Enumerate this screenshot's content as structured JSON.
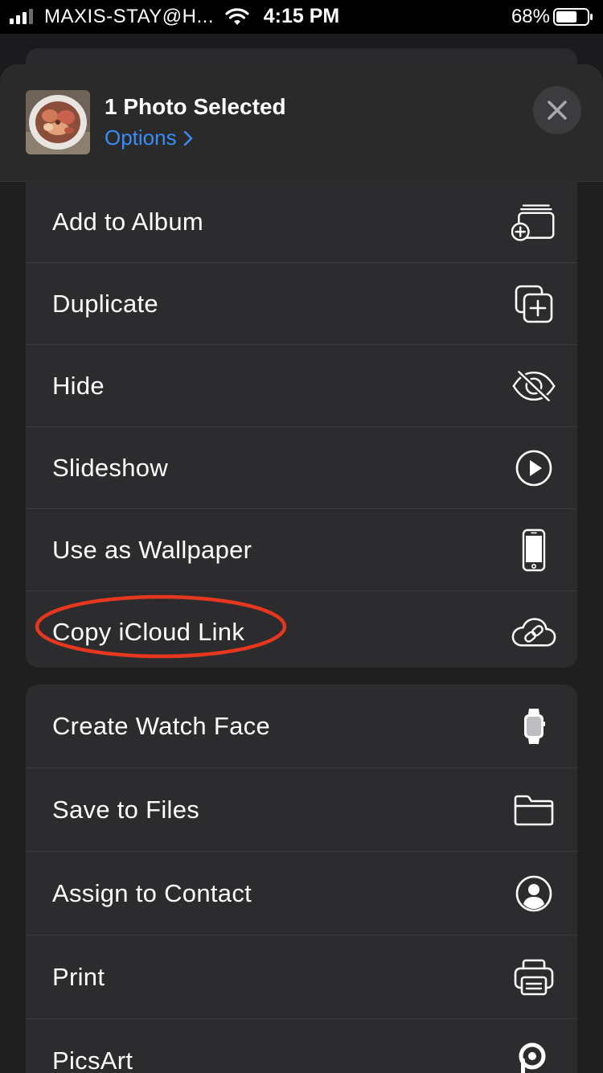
{
  "status_bar": {
    "carrier": "MAXIS-STAY@H...",
    "time": "4:15 PM",
    "battery_percent": "68%",
    "battery_level": 0.68
  },
  "header": {
    "title": "1 Photo Selected",
    "options_label": "Options",
    "thumbnail_icon": "photo-thumbnail-food-bowl"
  },
  "close_icon": "close-icon",
  "actions_group1": [
    {
      "label": "Add to Album",
      "icon": "add-to-album-icon"
    },
    {
      "label": "Duplicate",
      "icon": "duplicate-icon"
    },
    {
      "label": "Hide",
      "icon": "eye-slash-icon"
    },
    {
      "label": "Slideshow",
      "icon": "play-circle-icon"
    },
    {
      "label": "Use as Wallpaper",
      "icon": "iphone-icon"
    },
    {
      "label": "Copy iCloud Link",
      "icon": "cloud-link-icon",
      "highlighted": true
    }
  ],
  "actions_group2": [
    {
      "label": "Create Watch Face",
      "icon": "watch-icon"
    },
    {
      "label": "Save to Files",
      "icon": "folder-icon"
    },
    {
      "label": "Assign to Contact",
      "icon": "person-circle-icon"
    },
    {
      "label": "Print",
      "icon": "printer-icon"
    },
    {
      "label": "PicsArt",
      "icon": "picsart-icon"
    }
  ],
  "colors": {
    "accent_blue": "#3a8cf7",
    "highlight_red": "#e8371f",
    "sheet_bg": "#2c2c2e"
  }
}
